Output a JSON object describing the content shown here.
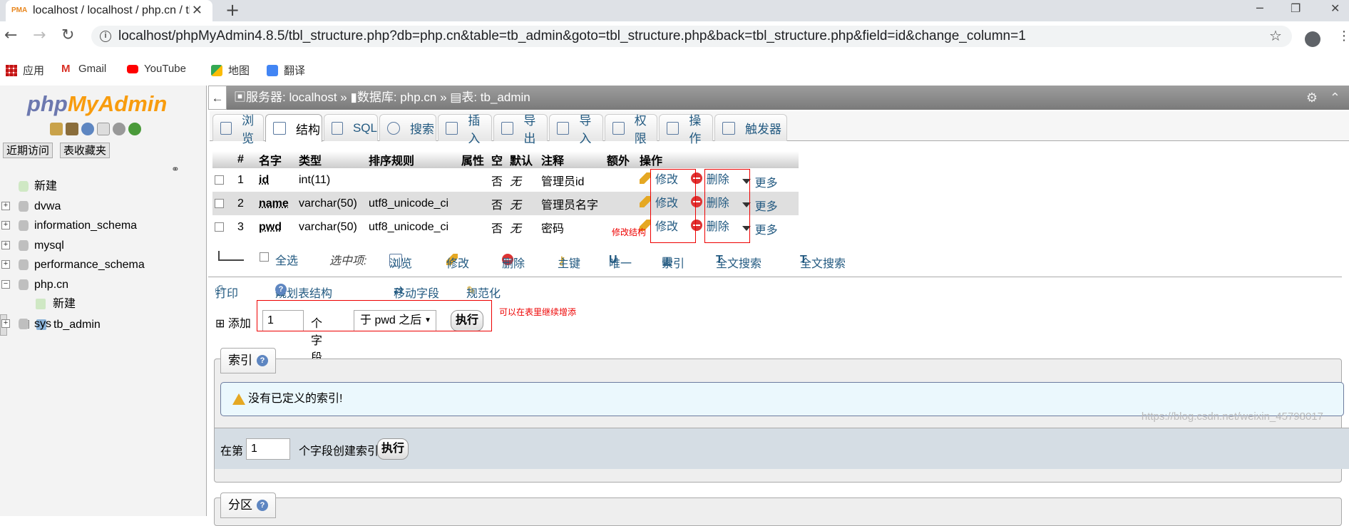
{
  "browser": {
    "tab_title": "localhost / localhost / php.cn / tb_admin",
    "favicon_text": "PMA",
    "new_tab": "+",
    "url": "localhost/phpMyAdmin4.8.5/tbl_structure.php?db=php.cn&table=tb_admin&goto=tbl_structure.php&back=tbl_structure.php&field=id&change_column=1",
    "bookmarks": [
      {
        "label": "应用",
        "icon": "apps-grid-icon"
      },
      {
        "label": "Gmail",
        "icon": "gmail-icon"
      },
      {
        "label": "YouTube",
        "icon": "youtube-icon"
      },
      {
        "label": "地图",
        "icon": "maps-icon"
      },
      {
        "label": "翻译",
        "icon": "translate-icon"
      }
    ]
  },
  "sidebar": {
    "logo_php": "php",
    "logo_myadmin": "MyAdmin",
    "recent_btn": "近期访问",
    "favorites_btn": "表收藏夹",
    "tree": [
      {
        "label": "新建",
        "level": 0
      },
      {
        "label": "dvwa",
        "level": 0
      },
      {
        "label": "information_schema",
        "level": 0
      },
      {
        "label": "mysql",
        "level": 0
      },
      {
        "label": "performance_schema",
        "level": 0
      },
      {
        "label": "php.cn",
        "level": 0
      },
      {
        "label": "新建",
        "level": 1
      },
      {
        "label": "tb_admin",
        "level": 1
      },
      {
        "label": "sys",
        "level": 0
      }
    ]
  },
  "breadcrumb": {
    "server_label": "服务器: localhost",
    "db_label": "数据库: php.cn",
    "table_label": "表: tb_admin",
    "sep": "»"
  },
  "tabs": [
    {
      "label": "浏览"
    },
    {
      "label": "结构"
    },
    {
      "label": "SQL"
    },
    {
      "label": "搜索"
    },
    {
      "label": "插入"
    },
    {
      "label": "导出"
    },
    {
      "label": "导入"
    },
    {
      "label": "权限"
    },
    {
      "label": "操作"
    },
    {
      "label": "触发器"
    }
  ],
  "structure": {
    "headers": [
      "#",
      "名字",
      "类型",
      "排序规则",
      "属性",
      "空",
      "默认",
      "注释",
      "额外",
      "操作"
    ],
    "rows": [
      {
        "num": "1",
        "name": "id",
        "type": "int(11)",
        "collation": "",
        "null": "否",
        "default": "无",
        "comment": "管理员id"
      },
      {
        "num": "2",
        "name": "name",
        "type": "varchar(50)",
        "collation": "utf8_unicode_ci",
        "null": "否",
        "default": "无",
        "comment": "管理员名字"
      },
      {
        "num": "3",
        "name": "pwd",
        "type": "varchar(50)",
        "collation": "utf8_unicode_ci",
        "null": "否",
        "default": "无",
        "comment": "密码"
      }
    ],
    "edit_label": "修改",
    "drop_label": "删除",
    "more_label": "更多"
  },
  "annotations": {
    "edit_note": "修改结构",
    "add_note": "可以在表里继续增添"
  },
  "select_bar": {
    "check_all": "全选",
    "with_selected": "选中项:",
    "browse": "浏览",
    "change": "修改",
    "drop": "删除",
    "primary": "主键",
    "unique": "唯一",
    "index": "索引",
    "fulltext1": "全文搜索",
    "fulltext2": "全文搜索"
  },
  "tools": {
    "print": "打印",
    "propose": "规划表结构",
    "move": "移动字段",
    "normalize": "规范化"
  },
  "add_fields": {
    "label": "添加",
    "count": "1",
    "unit": "个字段",
    "position": "于 pwd 之后",
    "go": "执行"
  },
  "indexes": {
    "legend": "索引",
    "notice": "没有已定义的索引!",
    "create_prefix": "在第",
    "create_count": "1",
    "create_suffix": "个字段创建索引",
    "go": "执行"
  },
  "partitions": {
    "legend": "分区"
  },
  "watermark": "https://blog.csdn.net/weixin_45798017"
}
